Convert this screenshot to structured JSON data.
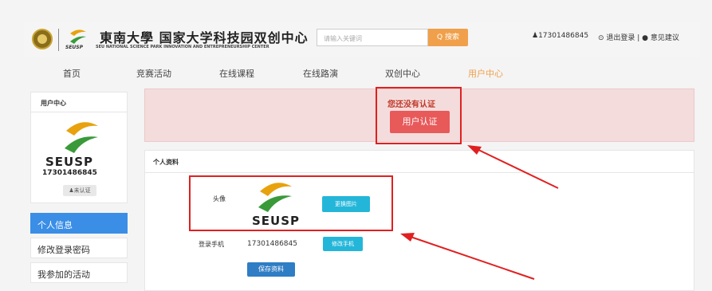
{
  "header": {
    "small_logo_text": "SEUSP",
    "brand_cn": "東南大學 国家大学科技园双创中心",
    "brand_en": "SEU NATIONAL SCIENCE PARK INNOVATION AND ENTREPRENEURSHIP CENTER",
    "search_placeholder": "请输入关键词",
    "search_button": "Q 搜索",
    "user_phone": "♟17301486845",
    "logout_feedback": "⊙ 退出登录 | ● 意见建议"
  },
  "nav": {
    "items": [
      "首页",
      "竞赛活动",
      "在线课程",
      "在线路演",
      "双创中心",
      "用户中心"
    ],
    "active_index": 5
  },
  "sidebar": {
    "title": "用户中心",
    "logo_text": "SEUSP",
    "phone": "17301486845",
    "badge": "♟未认证",
    "menu": [
      "个人信息",
      "修改登录密码",
      "我参加的活动"
    ],
    "active_index": 0
  },
  "alert": {
    "message": "您还没有认证",
    "button": "用户认证"
  },
  "profile": {
    "title": "个人资料",
    "avatar_label": "头像",
    "avatar_text": "SEUSP",
    "change_photo": "更换图片",
    "phone_label": "登录手机",
    "phone_value": "17301486845",
    "change_phone": "修改手机",
    "save": "保存资料"
  },
  "colors": {
    "accent": "#f0a04b",
    "active_menu": "#3a8ee6",
    "alert_bg": "#f4dcdc",
    "alert_btn": "#e8595a",
    "cyan_btn": "#24b6d9",
    "save_btn": "#2f7dc4",
    "annotation": "#e02020"
  }
}
